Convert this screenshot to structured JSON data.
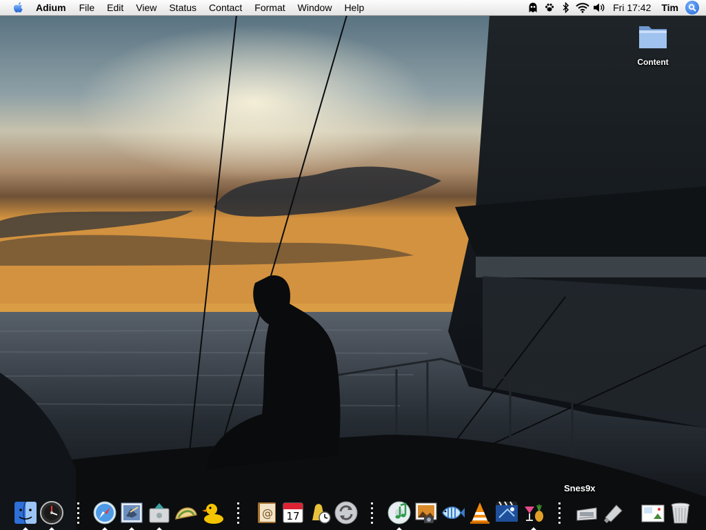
{
  "menubar": {
    "app_name": "Adium",
    "items": [
      "File",
      "Edit",
      "View",
      "Status",
      "Contact",
      "Format",
      "Window",
      "Help"
    ],
    "clock": "Fri 17:42",
    "user": "Tim",
    "extras": [
      "ghost-icon",
      "pawprint-icon",
      "bluetooth-icon",
      "wifi-icon",
      "volume-icon"
    ]
  },
  "desktop": {
    "folder_label": "Content"
  },
  "dock": {
    "tooltip": "Snes9x",
    "items": [
      "Finder",
      "Dashboard",
      "Safari",
      "Mail",
      "iPhoto Uploader",
      "Taco HTML Edit",
      "Cyberduck",
      "Address Book",
      "iCal",
      "Time Tracker",
      "iSync",
      "iTunes",
      "iPhoto",
      "Fish",
      "VLC",
      "iMovie",
      "Cocktail",
      "Snes9x",
      "USB Overdrive",
      "Preview",
      "Trash"
    ]
  },
  "colors": {
    "menubar_bg": "#ececec",
    "spotlight": "#1d63d6",
    "folder_blue": "#8fb6e6"
  }
}
